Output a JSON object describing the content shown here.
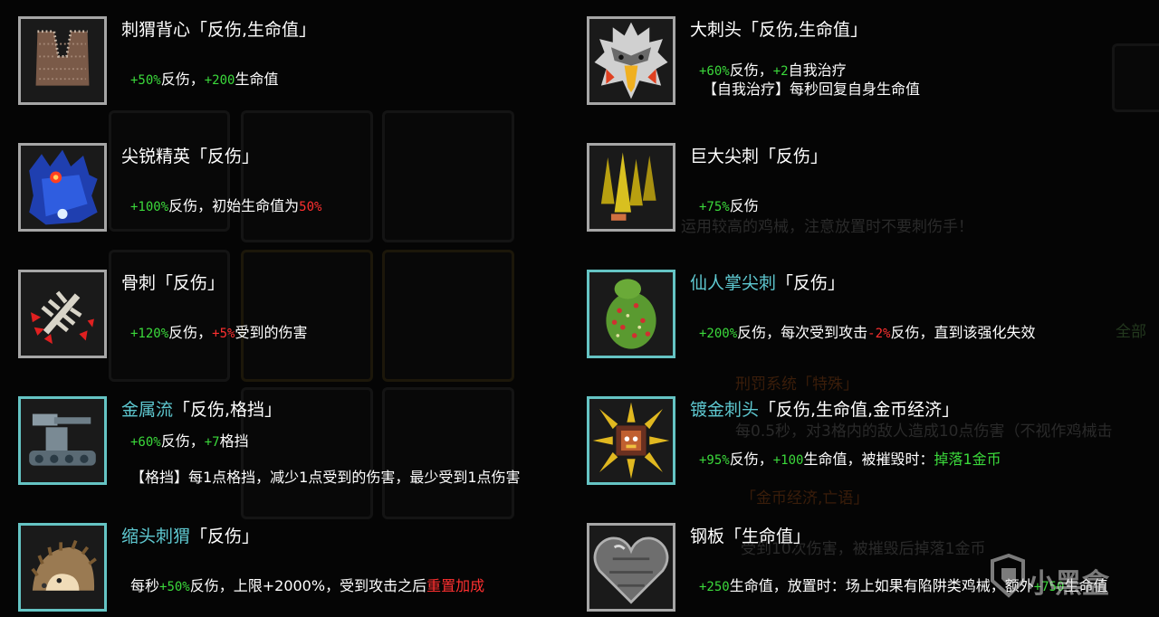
{
  "cards": [
    {
      "name": "刺猬背心",
      "tags": "「反伤,生命值」",
      "desc": [
        {
          "t": "+50%",
          "c": "g"
        },
        {
          "t": "反伤，"
        },
        {
          "t": "+200",
          "c": "g"
        },
        {
          "t": "生命值"
        }
      ]
    },
    {
      "name": "尖锐精英",
      "tags": "「反伤」",
      "desc": [
        {
          "t": "+100%",
          "c": "g"
        },
        {
          "t": "反伤，初始生命值为"
        },
        {
          "t": "50%",
          "c": "r"
        }
      ]
    },
    {
      "name": "骨刺",
      "tags": "「反伤」",
      "desc": [
        {
          "t": "+120%",
          "c": "g"
        },
        {
          "t": "反伤，"
        },
        {
          "t": "+5%",
          "c": "r"
        },
        {
          "t": "受到的伤害"
        }
      ]
    },
    {
      "name": "金属流",
      "tags": "「反伤,格挡」",
      "desc": [
        {
          "t": "+60%",
          "c": "g"
        },
        {
          "t": "反伤，"
        },
        {
          "t": "+7",
          "c": "g"
        },
        {
          "t": "格挡"
        }
      ],
      "desc2": "【格挡】每1点格挡，减少1点受到的伤害，最少受到1点伤害"
    },
    {
      "name": "缩头刺猬",
      "tags": "「反伤」",
      "desc": [
        {
          "t": "每秒"
        },
        {
          "t": "+50%",
          "c": "g"
        },
        {
          "t": "反伤，上限+2000%，受到攻击之后"
        },
        {
          "t": "重置加成",
          "c": "rt"
        }
      ]
    },
    {
      "name": "大刺头",
      "tags": "「反伤,生命值」",
      "desc": [
        {
          "t": "+60%",
          "c": "g"
        },
        {
          "t": "反伤，"
        },
        {
          "t": "+2",
          "c": "g"
        },
        {
          "t": "自我治疗"
        }
      ],
      "desc2": "【自我治疗】每秒回复自身生命值"
    },
    {
      "name": "巨大尖刺",
      "tags": "「反伤」",
      "desc": [
        {
          "t": "+75%",
          "c": "g"
        },
        {
          "t": "反伤"
        }
      ]
    },
    {
      "name": "仙人掌尖刺",
      "tags": "「反伤」",
      "desc": [
        {
          "t": "+200%",
          "c": "g"
        },
        {
          "t": "反伤，每次受到攻击"
        },
        {
          "t": "-2%",
          "c": "r"
        },
        {
          "t": "反伤，直到该强化失效"
        }
      ]
    },
    {
      "name": "镀金刺头",
      "tags": "「反伤,生命值,金币经济」",
      "desc": [
        {
          "t": "+95%",
          "c": "g"
        },
        {
          "t": "反伤，"
        },
        {
          "t": "+100",
          "c": "g"
        },
        {
          "t": "生命值，被摧毁时："
        },
        {
          "t": "掉落1金币",
          "c": "gt"
        }
      ]
    },
    {
      "name": "钢板",
      "tags": "「生命值」",
      "desc": [
        {
          "t": "+250",
          "c": "g"
        },
        {
          "t": "生命值，放置时：场上如果有陷阱类鸡械，额外"
        },
        {
          "t": "+750",
          "c": "g"
        },
        {
          "t": "生命值"
        }
      ]
    }
  ],
  "background": {
    "texts": [
      "运用较高的鸡械，注意放置时不要刺伤手！",
      "刑罚系统「特殊」",
      "每0.5秒，对3格内的敌人造成10点伤害（不视作鸡械击",
      "「金币经济,亡语」",
      "受到10次伤害，被摧毁后掉落1金币",
      "全部"
    ]
  },
  "watermark": {
    "text": "小黑盒"
  },
  "colors": {
    "green": "#3bd93b",
    "red": "#ff3030",
    "teal": "#5ec8d0",
    "frame": "#a6a6a6"
  }
}
